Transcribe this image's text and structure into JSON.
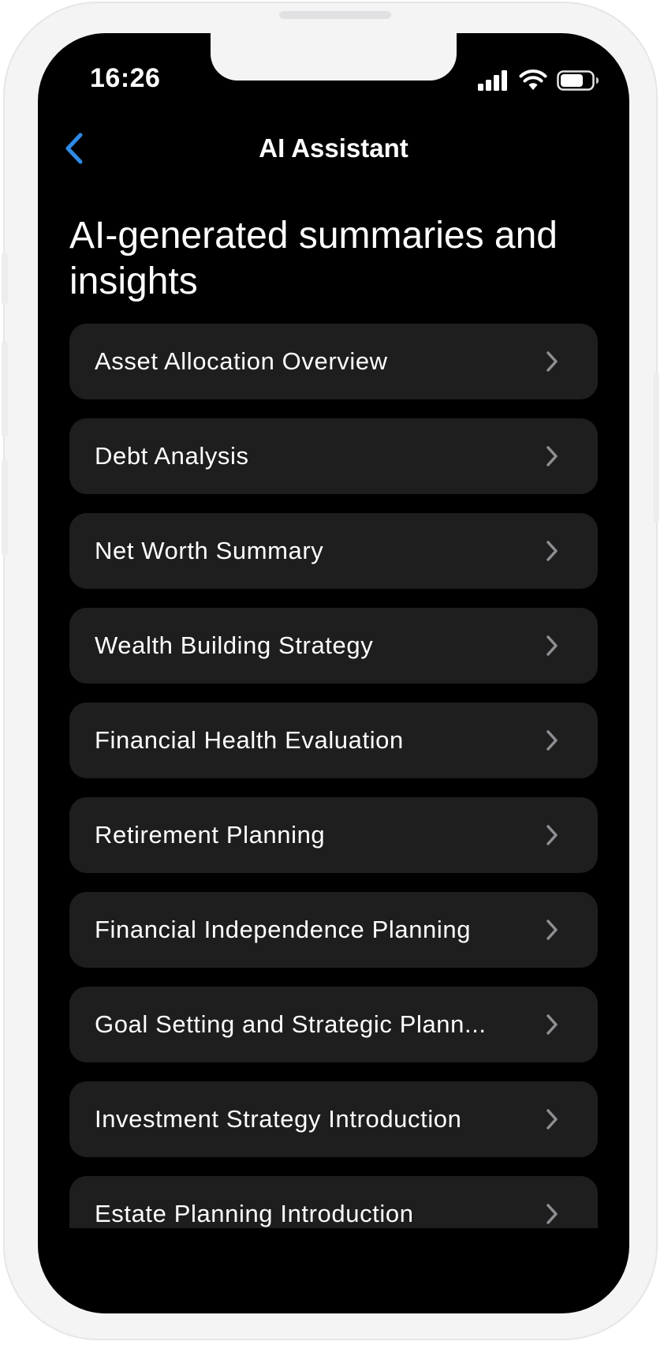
{
  "status_bar": {
    "time": "16:26",
    "icons": [
      "signal-icon",
      "wifi-icon",
      "battery-icon"
    ]
  },
  "nav": {
    "back_icon": "chevron-left-icon",
    "title": "AI Assistant"
  },
  "heading": "AI-generated summaries and insights",
  "items": [
    {
      "label": "Asset Allocation Overview"
    },
    {
      "label": "Debt Analysis"
    },
    {
      "label": "Net Worth Summary"
    },
    {
      "label": "Wealth Building Strategy"
    },
    {
      "label": "Financial Health Evaluation"
    },
    {
      "label": "Retirement Planning"
    },
    {
      "label": "Financial Independence Planning"
    },
    {
      "label": "Goal Setting and Strategic Plann..."
    },
    {
      "label": "Investment Strategy Introduction"
    },
    {
      "label": "Estate Planning Introduction"
    }
  ],
  "colors": {
    "background": "#000000",
    "card": "#1e1e1f",
    "text": "#ffffff",
    "accent": "#2f8ae6",
    "chevron": "#8e8e93",
    "device_frame": "#f4f4f5"
  }
}
